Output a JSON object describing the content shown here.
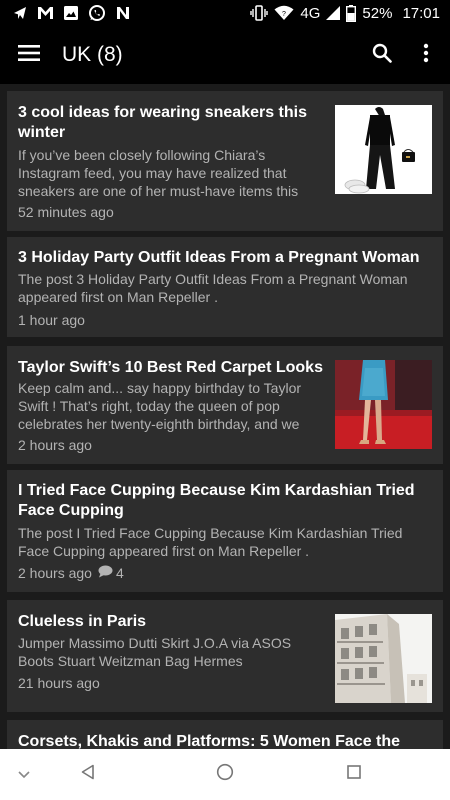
{
  "status_bar": {
    "battery": "52%",
    "time": "17:01",
    "network": "4G",
    "left_icons": [
      "telegram-icon",
      "gmail-icon",
      "photo-icon",
      "whatsapp-icon",
      "app-n-icon"
    ],
    "right_icons": [
      "vibrate-icon",
      "wifi-icon",
      "signal-icon",
      "battery-icon"
    ]
  },
  "app_bar": {
    "title": "UK (8)",
    "icons": [
      "menu-icon",
      "search-icon",
      "overflow-menu-icon"
    ]
  },
  "feed": {
    "items": [
      {
        "title": "3 cool ideas for wearing sneakers this winter",
        "excerpt": "If you’ve been closely following Chiara’s Instagram feed, you may have realized that sneakers are one of her must-have items this",
        "time": "52 minutes ago",
        "has_thumbnail": true
      },
      {
        "title": "3 Holiday Party Outfit Ideas From a Pregnant Woman",
        "excerpt": "The post 3 Holiday Party Outfit Ideas From a Pregnant Woman appeared first on Man Repeller .",
        "time": "1 hour ago",
        "has_thumbnail": false
      },
      {
        "title": "Taylor Swift’s 10 Best Red Carpet Looks",
        "excerpt": "Keep calm and... say happy birthday to Taylor Swift ! That’s right, today the queen of pop celebrates her twenty-eighth birthday, and we",
        "time": "2 hours ago",
        "has_thumbnail": true
      },
      {
        "title": "I Tried Face Cupping Because Kim Kardashian Tried Face Cupping",
        "excerpt": "The post I Tried Face Cupping Because Kim Kardashian Tried Face Cupping appeared first on Man Repeller .",
        "time": "2 hours ago",
        "comments": "4",
        "has_thumbnail": false
      },
      {
        "title": "Clueless in Paris",
        "excerpt": "Jumper Massimo Dutti Skirt J.O.A via ASOS Boots Stuart Weitzman Bag Hermes",
        "time": "21 hours ago",
        "has_thumbnail": true
      },
      {
        "title": "Corsets, Khakis and Platforms: 5 Women Face the",
        "has_thumbnail": false
      }
    ]
  },
  "nav_bar": {
    "icons": [
      "collapse-chevron-icon",
      "back-icon",
      "home-icon",
      "recents-icon"
    ]
  },
  "colors": {
    "background": "#1b1b1b",
    "card": "#2d2d2d",
    "bar": "#000000",
    "title_text": "#ffffff",
    "secondary_text": "#b3b3b3",
    "nav_bar": "#ffffff"
  }
}
